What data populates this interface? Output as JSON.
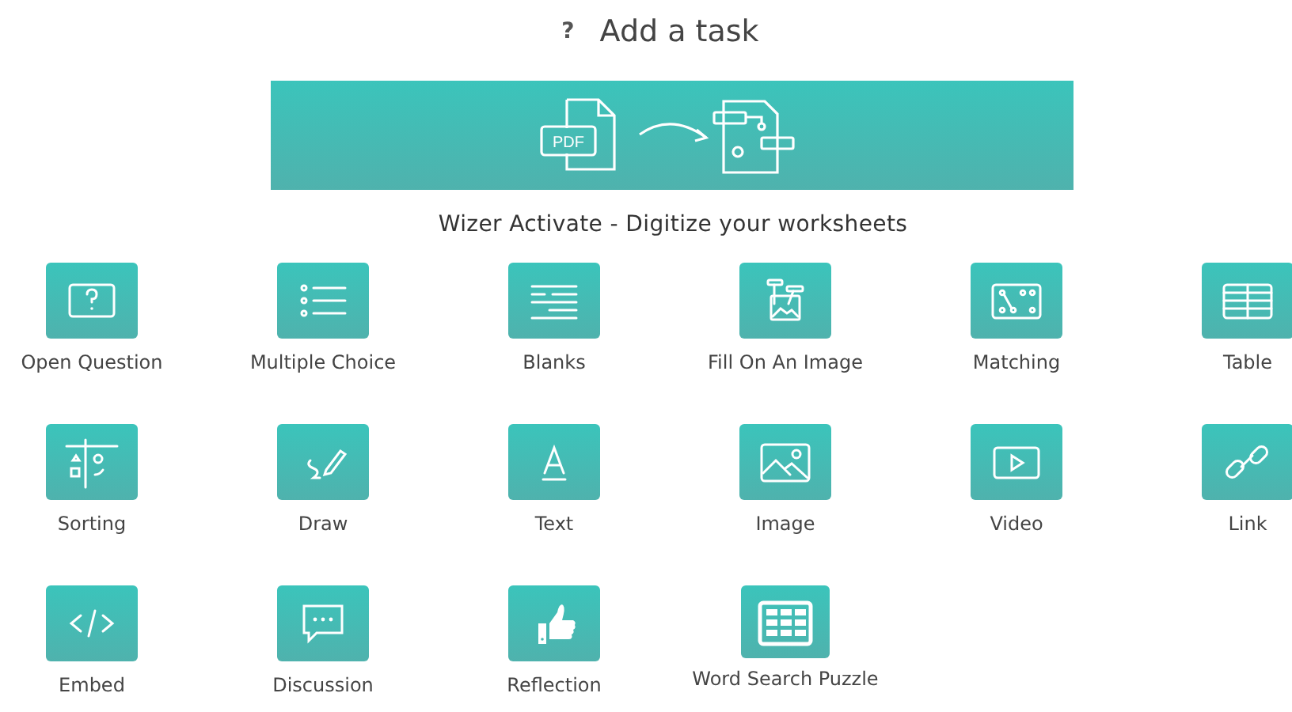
{
  "header": {
    "help": "?",
    "title": "Add a task"
  },
  "banner": {
    "caption": "Wizer Activate - Digitize your worksheets",
    "badge": "PDF"
  },
  "tasks": [
    {
      "label": "Open Question",
      "kind": "question"
    },
    {
      "label": "Multiple Choice",
      "kind": "choice"
    },
    {
      "label": "Blanks",
      "kind": "blanks"
    },
    {
      "label": "Fill On An Image",
      "kind": "fill"
    },
    {
      "label": "Matching",
      "kind": "matching"
    },
    {
      "label": "Table",
      "kind": "table"
    },
    {
      "label": "Sorting",
      "kind": "sorting"
    },
    {
      "label": "Draw",
      "kind": "draw"
    },
    {
      "label": "Text",
      "kind": "text"
    },
    {
      "label": "Image",
      "kind": "image"
    },
    {
      "label": "Video",
      "kind": "video"
    },
    {
      "label": "Link",
      "kind": "link"
    },
    {
      "label": "Embed",
      "kind": "embed"
    },
    {
      "label": "Discussion",
      "kind": "discussion"
    },
    {
      "label": "Reflection",
      "kind": "reflection"
    },
    {
      "label": "Word Search Puzzle",
      "kind": "wordsearch"
    }
  ]
}
